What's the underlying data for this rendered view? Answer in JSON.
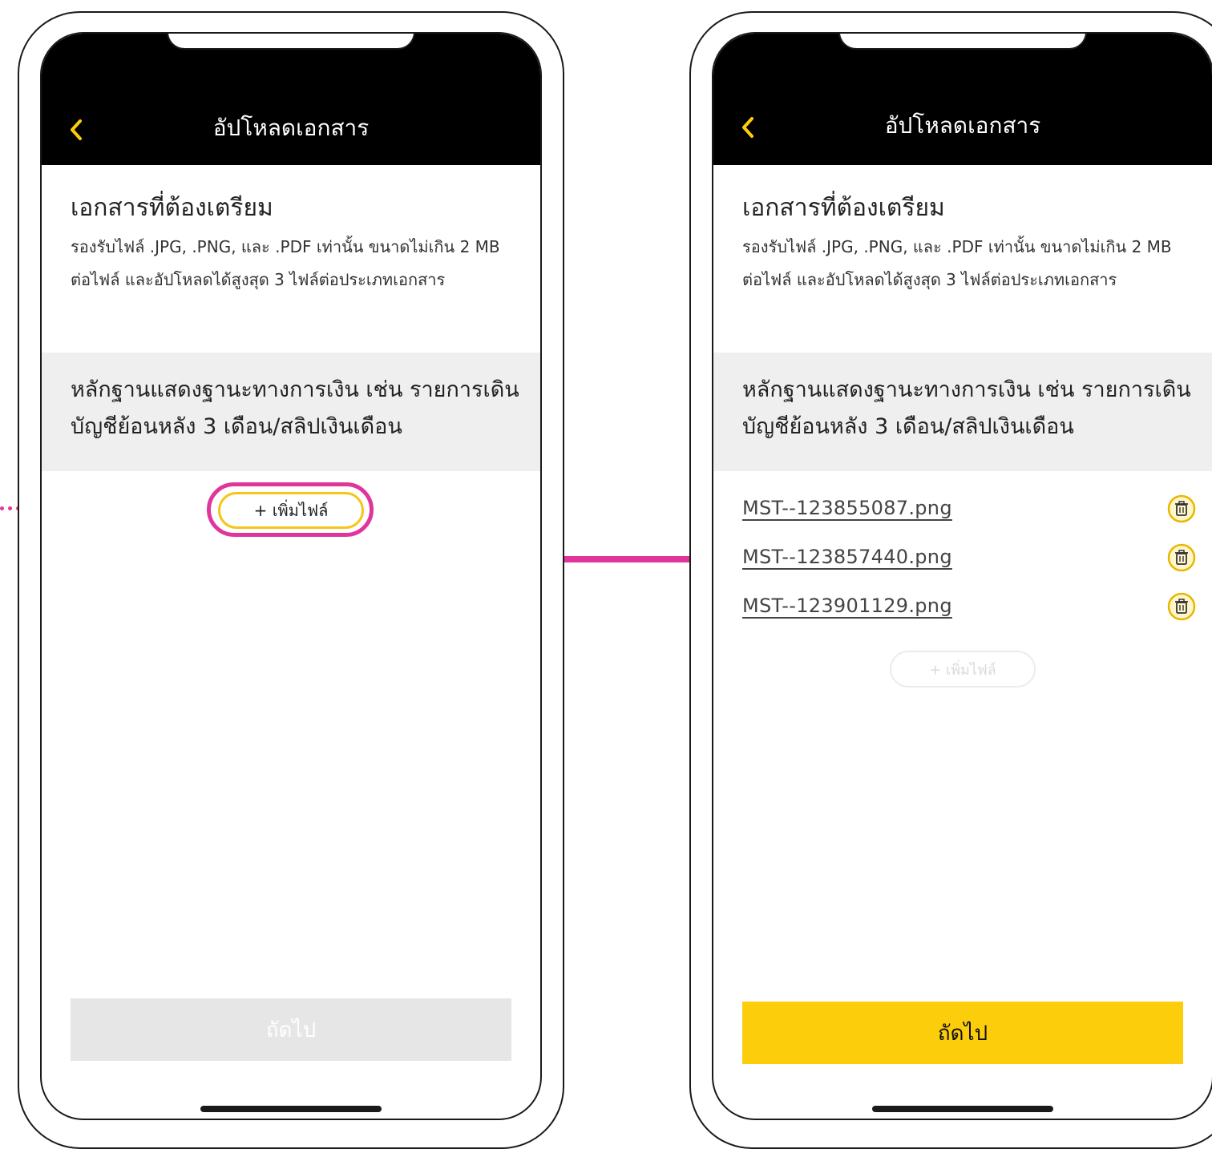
{
  "colors": {
    "accent_yellow": "#fccd0a",
    "highlight_pink": "#e0359a",
    "header_black": "#000000",
    "doc_box_gray": "#efefef",
    "disabled_gray": "#e6e6e6"
  },
  "left_screen": {
    "header": {
      "back_icon": "chevron-left-icon",
      "title": "อัปโหลดเอกสาร"
    },
    "section_title": "เอกสารที่ต้องเตรียม",
    "section_desc": "รองรับไฟล์ .JPG, .PNG, และ .PDF เท่านั้น ขนาดไม่เกิน 2 MB ต่อไฟล์ และอัปโหลดได้สูงสุด 3 ไฟล์ต่อประเภทเอกสาร",
    "doc_type": "หลักฐานแสดงฐานะทางการเงิน เช่น รายการเดินบัญชีย้อนหลัง 3 เดือน/สลิปเงินเดือน",
    "add_file_label": "+ เพิ่มไฟล์",
    "next_label": "ถัดไป",
    "next_state": "disabled"
  },
  "right_screen": {
    "header": {
      "back_icon": "chevron-left-icon",
      "title": "อัปโหลดเอกสาร"
    },
    "section_title": "เอกสารที่ต้องเตรียม",
    "section_desc": "รองรับไฟล์ .JPG, .PNG, และ .PDF เท่านั้น ขนาดไม่เกิน 2 MB ต่อไฟล์ และอัปโหลดได้สูงสุด 3 ไฟล์ต่อประเภทเอกสาร",
    "doc_type": "หลักฐานแสดงฐานะทางการเงิน เช่น รายการเดินบัญชีย้อนหลัง 3 เดือน/สลิปเงินเดือน",
    "files": [
      {
        "name": "MST--123855087.png",
        "icon": "trash-icon"
      },
      {
        "name": "MST--123857440.png",
        "icon": "trash-icon"
      },
      {
        "name": "MST--123901129.png",
        "icon": "trash-icon"
      }
    ],
    "add_file_label": "+ เพิ่มไฟล์",
    "add_file_state": "disabled",
    "next_label": "ถัดไป",
    "next_state": "enabled"
  }
}
